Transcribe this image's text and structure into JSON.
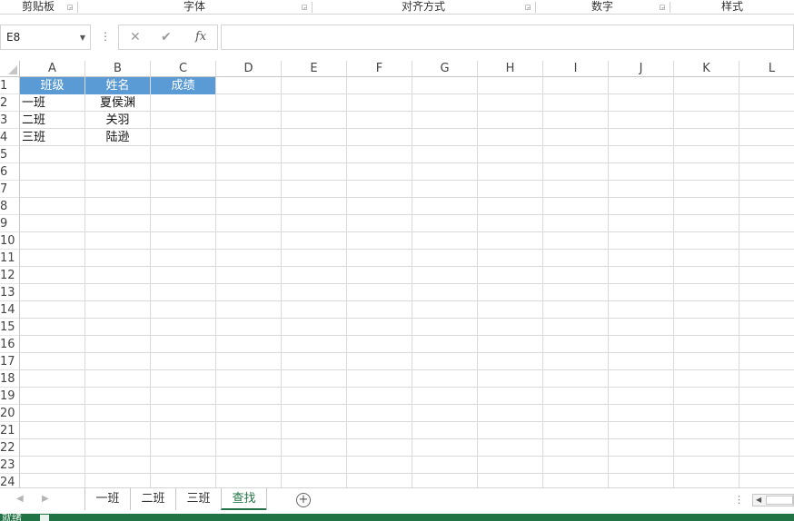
{
  "ribbon": {
    "groups": [
      {
        "label": "剪贴板"
      },
      {
        "label": "字体"
      },
      {
        "label": "对齐方式"
      },
      {
        "label": "数字"
      },
      {
        "label": "样式"
      }
    ]
  },
  "formula_bar": {
    "name_box": "E8",
    "formula": ""
  },
  "grid": {
    "columns": [
      "A",
      "B",
      "C",
      "D",
      "E",
      "F",
      "G",
      "H",
      "I",
      "J",
      "K",
      "L"
    ],
    "rows": [
      "1",
      "2",
      "3",
      "4",
      "5",
      "6",
      "7",
      "8",
      "9",
      "10",
      "11",
      "12",
      "13",
      "14",
      "15",
      "16",
      "17",
      "18",
      "19",
      "20",
      "21",
      "22",
      "23",
      "24"
    ],
    "header_fill": "#5b9bd5",
    "cells": {
      "A1": "班级",
      "B1": "姓名",
      "C1": "成绩",
      "A2": "一班",
      "B2": "夏侯渊",
      "A3": "二班",
      "B3": "关羽",
      "A4": "三班",
      "B4": "陆逊"
    }
  },
  "sheets": {
    "tabs": [
      "一班",
      "二班",
      "三班",
      "查找"
    ],
    "active": "查找",
    "accent": "#217346"
  },
  "status": {
    "text": "就绪"
  }
}
